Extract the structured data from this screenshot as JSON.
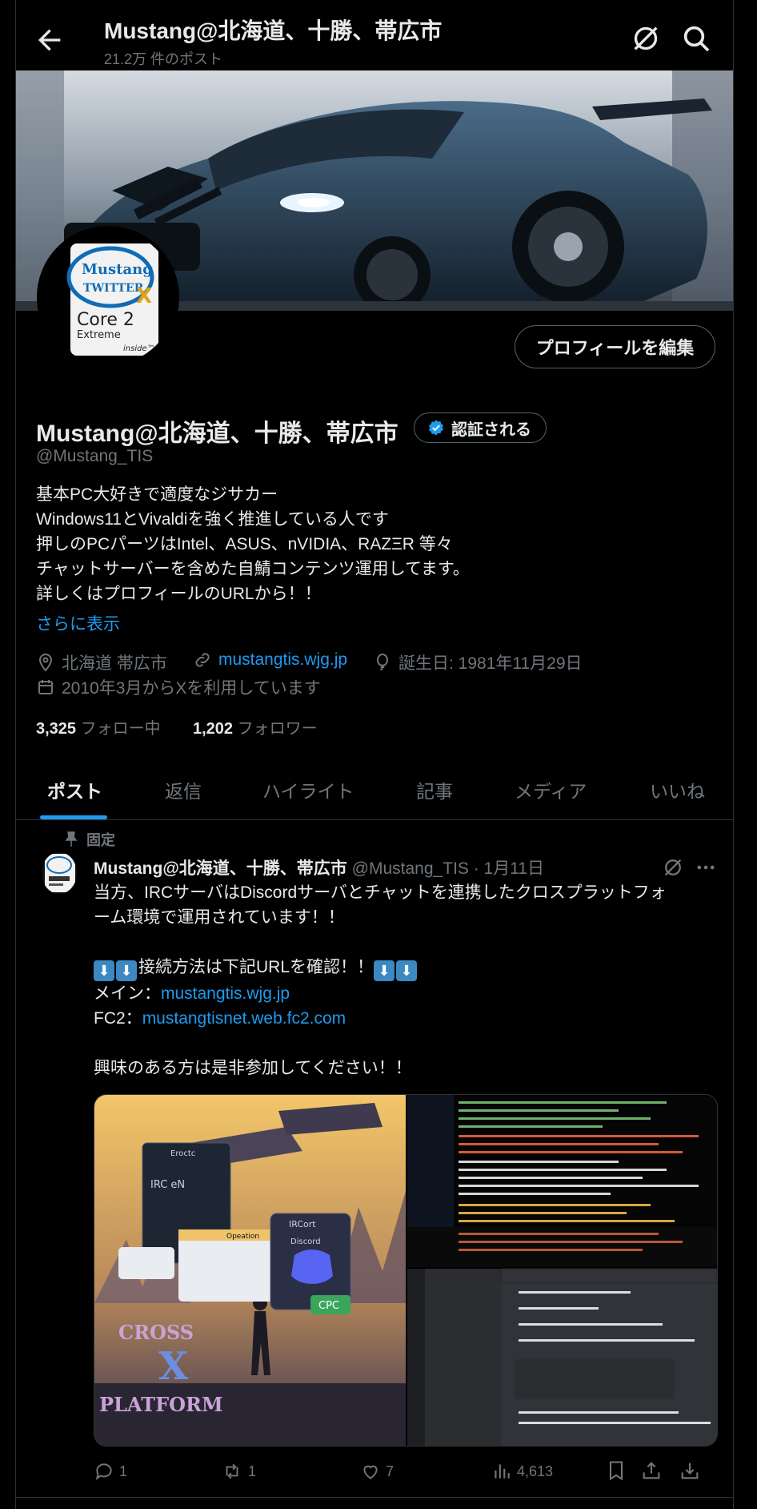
{
  "header": {
    "title": "Mustang@北海道、十勝、帯広市",
    "post_count": "21.2万 件のポスト"
  },
  "profile": {
    "edit_button": "プロフィールを編集",
    "name": "Mustang@北海道、十勝、帯広市",
    "verified_label": "認証される",
    "handle": "@Mustang_TIS",
    "bio": [
      "基本PC大好きで適度なジサカー",
      "Windows11とVivaldiを強く推進している人です",
      "押しのPCパーツはIntel、ASUS、nVIDIA、RAZΞR 等々",
      "チャットサーバーを含めた自鯖コンテンツ運用してます。",
      "詳しくはプロフィールのURLから！！"
    ],
    "show_more": "さらに表示",
    "location": "北海道 帯広市",
    "website": "mustangtis.wjg.jp",
    "birthday": "誕生日: 1981年11月29日",
    "joined": "2010年3月からXを利用しています",
    "following_count": "3,325",
    "following_label": "フォロー中",
    "followers_count": "1,202",
    "followers_label": "フォロワー",
    "avatar_text": {
      "brand": "Mustang",
      "sub": "TWITTER",
      "x": "X",
      "core": "Core 2",
      "extreme": "Extreme",
      "inside": "inside™"
    }
  },
  "tabs": [
    "ポスト",
    "返信",
    "ハイライト",
    "記事",
    "メディア",
    "いいね"
  ],
  "post": {
    "pinned_label": "固定",
    "author_name": "Mustang@北海道、十勝、帯広市",
    "author_handle_date": "@Mustang_TIS · 1月11日",
    "text_line1": "当方、IRCサーバはDiscordサーバとチャットを連携したクロスプラットフォ",
    "text_line2": "ーム環境で運用されています！！",
    "arrow_icon": "⬇",
    "text_line3": "接続方法は下記URLを確認！！",
    "main_label": "メイン：",
    "main_url": "mustangtis.wjg.jp",
    "fc2_label": "FC2：",
    "fc2_url": "mustangtisnet.web.fc2.com",
    "text_line5": "興味のある方は是非参加してください！！",
    "media_text": {
      "cross": "CROSS",
      "x": "X",
      "platform": "PLATFORM",
      "ircen": "IRC eN",
      "discord": "Discord",
      "cpc": "CPC",
      "opeation": "Opeation",
      "ircort": "IRCort"
    },
    "replies": "1",
    "reposts": "1",
    "likes": "7",
    "views": "4,613"
  },
  "colors": {
    "accent": "#1d9bf0",
    "muted": "#71767b",
    "text": "#e7e9ea",
    "border": "#2f3336"
  }
}
